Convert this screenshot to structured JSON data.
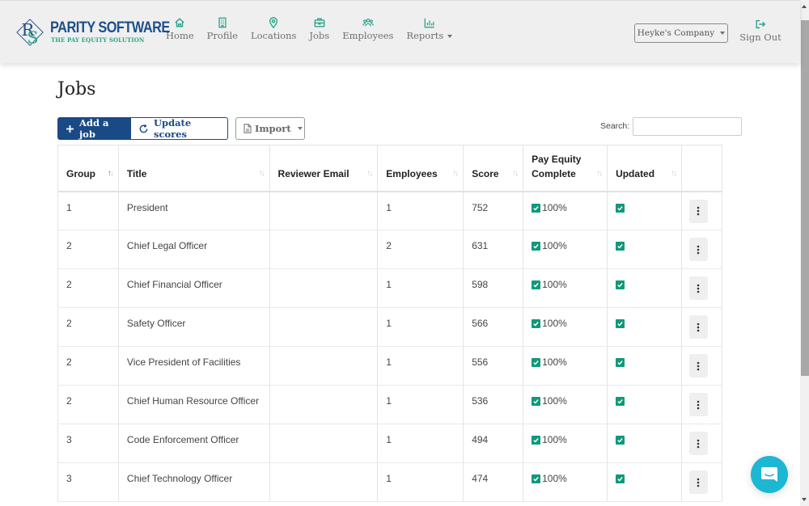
{
  "brand": {
    "title": "PARITY SOFTWARE",
    "subtitle": "THE PAY EQUITY SOLUTION",
    "monogram": "RS",
    "colors": {
      "primary": "#1a4a86",
      "accent": "#2aa68c",
      "check": "#11997a",
      "chat": "#1db7d4"
    }
  },
  "nav": {
    "items": [
      {
        "label": "Home",
        "icon": "home-icon"
      },
      {
        "label": "Profile",
        "icon": "building-icon"
      },
      {
        "label": "Locations",
        "icon": "map-pin-icon"
      },
      {
        "label": "Jobs",
        "icon": "briefcase-icon"
      },
      {
        "label": "Employees",
        "icon": "users-icon"
      },
      {
        "label": "Reports",
        "icon": "bar-chart-icon",
        "dropdown": true
      }
    ],
    "company": "Heyke's Company",
    "sign_out": "Sign Out"
  },
  "page": {
    "title": "Jobs",
    "buttons": {
      "add": "Add a job",
      "update": "Update scores",
      "import": "Import"
    },
    "search": {
      "label": "Search:",
      "value": "",
      "placeholder": ""
    }
  },
  "table": {
    "columns": [
      {
        "label": "Group",
        "sorted": "asc"
      },
      {
        "label": "Title"
      },
      {
        "label": "Reviewer Email"
      },
      {
        "label": "Employees"
      },
      {
        "label": "Score"
      },
      {
        "label": "Pay Equity Complete"
      },
      {
        "label": "Updated"
      },
      {
        "label": ""
      }
    ],
    "rows": [
      {
        "group": "1",
        "title": "President",
        "reviewer_email": "",
        "employees": "1",
        "score": "752",
        "pay_equity_complete": "100%",
        "pay_equity_checked": true,
        "updated": true
      },
      {
        "group": "2",
        "title": "Chief Legal Officer",
        "reviewer_email": "",
        "employees": "2",
        "score": "631",
        "pay_equity_complete": "100%",
        "pay_equity_checked": true,
        "updated": true
      },
      {
        "group": "2",
        "title": "Chief Financial Officer",
        "reviewer_email": "",
        "employees": "1",
        "score": "598",
        "pay_equity_complete": "100%",
        "pay_equity_checked": true,
        "updated": true
      },
      {
        "group": "2",
        "title": "Safety Officer",
        "reviewer_email": "",
        "employees": "1",
        "score": "566",
        "pay_equity_complete": "100%",
        "pay_equity_checked": true,
        "updated": true
      },
      {
        "group": "2",
        "title": "Vice President of Facilities",
        "reviewer_email": "",
        "employees": "1",
        "score": "556",
        "pay_equity_complete": "100%",
        "pay_equity_checked": true,
        "updated": true
      },
      {
        "group": "2",
        "title": "Chief Human Resource Officer",
        "reviewer_email": "",
        "employees": "1",
        "score": "536",
        "pay_equity_complete": "100%",
        "pay_equity_checked": true,
        "updated": true
      },
      {
        "group": "3",
        "title": "Code Enforcement Officer",
        "reviewer_email": "",
        "employees": "1",
        "score": "494",
        "pay_equity_complete": "100%",
        "pay_equity_checked": true,
        "updated": true
      },
      {
        "group": "3",
        "title": "Chief Technology Officer",
        "reviewer_email": "",
        "employees": "1",
        "score": "474",
        "pay_equity_complete": "100%",
        "pay_equity_checked": true,
        "updated": true
      }
    ]
  },
  "chat": {
    "icon": "chat-icon"
  }
}
